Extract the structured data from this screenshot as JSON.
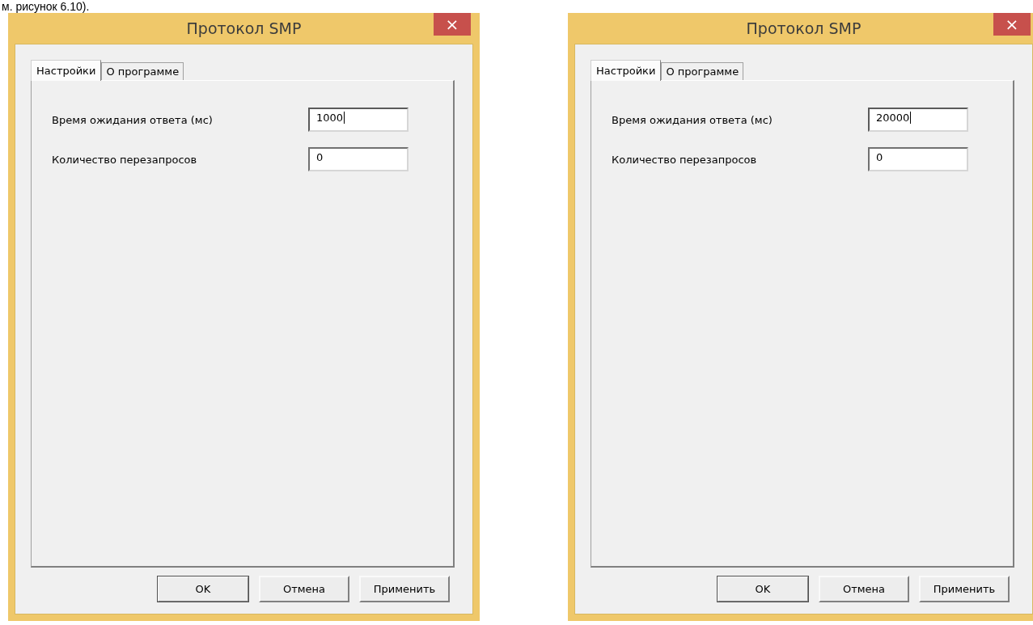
{
  "caption": "м. рисунок 6.10).",
  "dialogs": [
    {
      "title": "Протокол SMP",
      "close": "×",
      "tabs": [
        {
          "label": "Настройки",
          "selected": true
        },
        {
          "label": "О программе",
          "selected": false
        }
      ],
      "fields": [
        {
          "label": "Время ожидания ответа (мс)",
          "value": "1000",
          "focused": true
        },
        {
          "label": "Количество перезапросов",
          "value": "0",
          "focused": false
        }
      ],
      "buttons": [
        {
          "label": "OK",
          "default": true
        },
        {
          "label": "Отмена",
          "default": false
        },
        {
          "label": "Применить",
          "default": false
        }
      ]
    },
    {
      "title": "Протокол SMP",
      "close": "×",
      "tabs": [
        {
          "label": "Настройки",
          "selected": true
        },
        {
          "label": "О программе",
          "selected": false
        }
      ],
      "fields": [
        {
          "label": "Время ожидания ответа (мс)",
          "value": "20000",
          "focused": true
        },
        {
          "label": "Количество перезапросов",
          "value": "0",
          "focused": false
        }
      ],
      "buttons": [
        {
          "label": "OK",
          "default": true
        },
        {
          "label": "Отмена",
          "default": false
        },
        {
          "label": "Применить",
          "default": false
        }
      ]
    }
  ]
}
